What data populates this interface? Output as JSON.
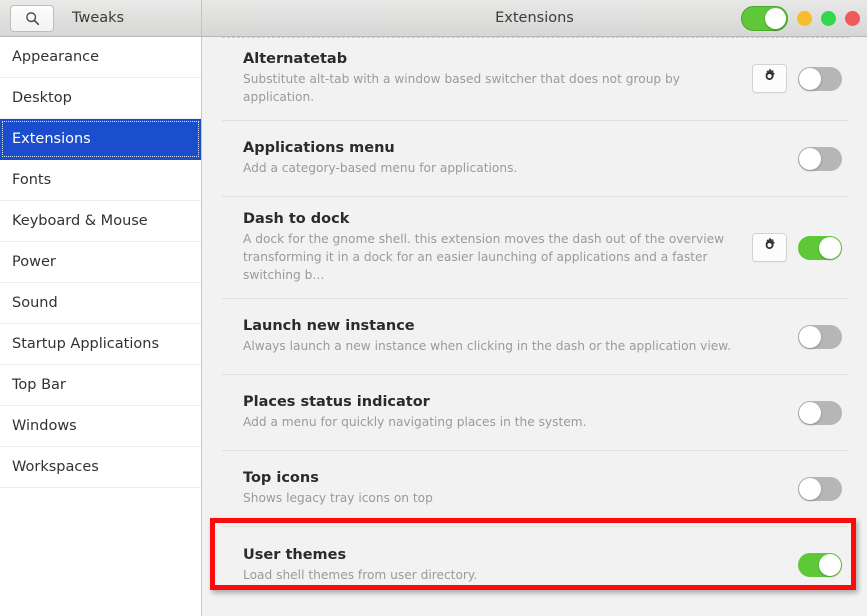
{
  "header": {
    "search_icon": "search-icon",
    "app_title": "Tweaks",
    "page_title": "Extensions",
    "global_switch_state": "on",
    "window_buttons": [
      {
        "name": "minimize",
        "color": "#f5bc2e"
      },
      {
        "name": "maximize",
        "color": "#32d74b"
      },
      {
        "name": "close",
        "color": "#f05a5a"
      }
    ]
  },
  "sidebar": {
    "items": [
      {
        "label": "Appearance",
        "selected": false
      },
      {
        "label": "Desktop",
        "selected": false
      },
      {
        "label": "Extensions",
        "selected": true
      },
      {
        "label": "Fonts",
        "selected": false
      },
      {
        "label": "Keyboard & Mouse",
        "selected": false
      },
      {
        "label": "Power",
        "selected": false
      },
      {
        "label": "Sound",
        "selected": false
      },
      {
        "label": "Startup Applications",
        "selected": false
      },
      {
        "label": "Top Bar",
        "selected": false
      },
      {
        "label": "Windows",
        "selected": false
      },
      {
        "label": "Workspaces",
        "selected": false
      }
    ],
    "selected_color": "#1b4ecc"
  },
  "extensions": [
    {
      "name": "Alternatetab",
      "description": "Substitute alt-tab with a window based switcher that does not group by application.",
      "has_settings": true,
      "settings_icon": "gear-icon",
      "enabled": false
    },
    {
      "name": "Applications menu",
      "description": "Add a category-based menu for applications.",
      "has_settings": false,
      "settings_icon": "gear-icon",
      "enabled": false
    },
    {
      "name": "Dash to dock",
      "description": "A dock for the gnome shell. this extension moves the dash out of the overview transforming it in a dock for an easier launching of applications and a faster switching b…",
      "has_settings": true,
      "settings_icon": "gear-icon",
      "enabled": true
    },
    {
      "name": "Launch new instance",
      "description": "Always launch a new instance when clicking in the dash or the application view.",
      "has_settings": false,
      "settings_icon": "gear-icon",
      "enabled": false
    },
    {
      "name": "Places status indicator",
      "description": "Add a menu for quickly navigating places in the system.",
      "has_settings": false,
      "settings_icon": "gear-icon",
      "enabled": false
    },
    {
      "name": "Top icons",
      "description": "Shows legacy tray icons on top",
      "has_settings": false,
      "settings_icon": "gear-icon",
      "enabled": false
    },
    {
      "name": "User themes",
      "description": "Load shell themes from user directory.",
      "has_settings": false,
      "settings_icon": "gear-icon",
      "enabled": true
    }
  ],
  "annotation": {
    "target": "User themes",
    "color": "#fb0b0b"
  },
  "colors": {
    "toggle_on": "#5fc838",
    "toggle_off": "#b6b6b4",
    "content_bg": "#f2f2f2",
    "sidebar_bg": "#ffffff"
  }
}
